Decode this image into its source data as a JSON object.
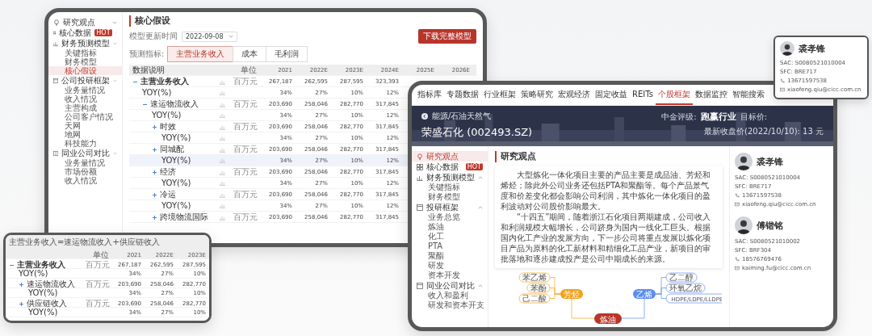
{
  "model_window": {
    "sidebar": [
      {
        "label": "研究观点"
      },
      {
        "label": "核心数据",
        "badge": "HOT"
      },
      {
        "label": "财务预测模型",
        "children": [
          {
            "label": "关键指标",
            "selected": false
          },
          {
            "label": "财务模型",
            "selected": false
          },
          {
            "label": "核心假设",
            "selected": true
          }
        ]
      },
      {
        "label": "公司投研框架",
        "children": [
          {
            "label": "业务量情况",
            "selected": false
          },
          {
            "label": "收入情况",
            "selected": false
          },
          {
            "label": "主营构成",
            "selected": false
          },
          {
            "label": "公司客户情况",
            "selected": false
          },
          {
            "label": "天网",
            "selected": false
          },
          {
            "label": "地网",
            "selected": false
          },
          {
            "label": "科技能力",
            "selected": false
          }
        ]
      },
      {
        "label": "同业公司对比",
        "children": [
          {
            "label": "业务量情况",
            "selected": false
          },
          {
            "label": "市场份额",
            "selected": false
          },
          {
            "label": "收入情况",
            "selected": false
          }
        ]
      }
    ],
    "title": "核心假设",
    "update_label": "模型更新时间",
    "update_value": "2022-09-08",
    "download_button": "下载完整模型",
    "metric_label": "预测指标:",
    "metric_tabs": [
      {
        "label": "主营业务收入",
        "selected": true
      },
      {
        "label": "成本",
        "selected": false
      },
      {
        "label": "毛利润",
        "selected": false
      }
    ],
    "table": {
      "columns": [
        "数据说明",
        "单位",
        "2021",
        "2022E",
        "2023E",
        "2024E",
        "2025E",
        "2026E"
      ],
      "rows": [
        {
          "label": "主营业务收入",
          "unit": "百万元",
          "values": [
            "267,187",
            "262,595",
            "287,595",
            "323,393"
          ],
          "expanded": true,
          "highlighted": false,
          "yoy": {
            "label": "YOY(%)",
            "values": [
              "34%",
              "27%",
              "10%",
              "12%"
            ],
            "highlighted": false
          },
          "children": [
            {
              "label": "速运物流收入",
              "unit": "百万元",
              "values": [
                "203,690",
                "258,046",
                "282,770",
                "317,845"
              ],
              "expanded": true,
              "highlighted": false,
              "yoy": {
                "label": "YOY(%)",
                "values": [
                  "34%",
                  "27%",
                  "10%",
                  "12%"
                ],
                "highlighted": false
              },
              "children": [
                {
                  "label": "时效",
                  "unit": "百万元",
                  "values": [
                    "203,690",
                    "258,046",
                    "282,770",
                    "317,845"
                  ],
                  "expanded": false,
                  "highlighted": false,
                  "yoy": {
                    "label": "YOY(%)",
                    "values": [
                      "34%",
                      "27%",
                      "10%",
                      "12%"
                    ],
                    "highlighted": false
                  }
                },
                {
                  "label": "同城配",
                  "unit": "百万元",
                  "values": [
                    "203,690",
                    "258,046",
                    "282,770",
                    "317,845"
                  ],
                  "expanded": false,
                  "highlighted": false,
                  "yoy": {
                    "label": "YOY(%)",
                    "values": [
                      "34%",
                      "27%",
                      "10%",
                      "12%"
                    ],
                    "highlighted": true
                  }
                },
                {
                  "label": "经济",
                  "unit": "百万元",
                  "values": [
                    "203,690",
                    "258,046",
                    "282,770",
                    "317,845"
                  ],
                  "expanded": false,
                  "highlighted": false,
                  "yoy": {
                    "label": "YOY(%)",
                    "values": [
                      "34%",
                      "27%",
                      "10%",
                      "12%"
                    ],
                    "highlighted": false
                  }
                },
                {
                  "label": "冷运",
                  "unit": "百万元",
                  "values": [
                    "203,690",
                    "258,046",
                    "282,770",
                    "317,845"
                  ],
                  "expanded": false,
                  "highlighted": false,
                  "yoy": {
                    "label": "YOY(%)",
                    "values": [
                      "34%",
                      "27%",
                      "10%",
                      "12%"
                    ],
                    "highlighted": false
                  }
                },
                {
                  "label": "跨境物流国际",
                  "unit": "百万元",
                  "values": [
                    "203,690",
                    "258,046",
                    "282,770",
                    "317,845"
                  ],
                  "expanded": false,
                  "highlighted": false
                }
              ]
            }
          ]
        }
      ]
    }
  },
  "mini_table": {
    "formula": "主营业务收入=速运物流收入+供应链收入",
    "columns": [
      "单位",
      "2021",
      "2022E",
      "2023E"
    ],
    "rows": [
      {
        "label": "主营业务收入",
        "unit": "百万元",
        "values": [
          "267,187",
          "262,595",
          "287,595"
        ],
        "expanded": true,
        "yoy": {
          "label": "YOY(%)",
          "values": [
            "34%",
            "27%",
            "10%"
          ]
        },
        "children": [
          {
            "label": "速运物流收入",
            "unit": "百万元",
            "values": [
              "203,690",
              "258,046",
              "282,770"
            ],
            "expanded": false,
            "yoy": {
              "label": "YOY(%)",
              "values": [
                "34%",
                "27%",
                "10%"
              ]
            }
          },
          {
            "label": "供应链收入",
            "unit": "百万元",
            "values": [
              "203,690",
              "258,046",
              "282,770"
            ],
            "expanded": false,
            "yoy": {
              "label": "YOY(%)",
              "values": [
                "34%",
                "27%",
                "10%"
              ]
            }
          }
        ]
      }
    ]
  },
  "stock_window": {
    "nav": [
      {
        "label": "指标库",
        "selected": false
      },
      {
        "label": "专题数据",
        "selected": false
      },
      {
        "label": "行业框架",
        "selected": false
      },
      {
        "label": "策略研究",
        "selected": false
      },
      {
        "label": "宏观经济",
        "selected": false
      },
      {
        "label": "固定收益",
        "selected": false
      },
      {
        "label": "REITs",
        "selected": false
      },
      {
        "label": "个股框架",
        "selected": true
      },
      {
        "label": "数据监控",
        "selected": false
      },
      {
        "label": "智能搜索",
        "selected": false
      }
    ],
    "banner": {
      "breadcrumb": "能源/石油天然气",
      "title": "荣盛石化 (002493.SZ)",
      "rating_label": "中金评级:",
      "rating": "跑赢行业",
      "target_label": "目标价:",
      "close_price": "最新收盘价(2022/10/10): 13 元"
    },
    "sidebar": [
      {
        "label": "研究观点",
        "selected": true
      },
      {
        "label": "核心数据",
        "badge": "HOT",
        "selected": false
      },
      {
        "label": "财务预测模型",
        "selected": false,
        "expanded": true,
        "children": [
          {
            "label": "关键指标",
            "selected": false
          },
          {
            "label": "财务模型",
            "selected": false
          }
        ]
      },
      {
        "label": "投研框架",
        "selected": false,
        "expanded": true,
        "children": [
          {
            "label": "业务总览",
            "selected": false
          },
          {
            "label": "炼油",
            "selected": false
          },
          {
            "label": "化工",
            "selected": false
          },
          {
            "label": "PTA",
            "selected": false
          },
          {
            "label": "聚酯",
            "selected": false
          },
          {
            "label": "研发",
            "selected": false
          },
          {
            "label": "资本开发",
            "selected": false
          }
        ]
      },
      {
        "label": "同业公司对比",
        "selected": false,
        "expanded": true,
        "children": [
          {
            "label": "收入和盈利",
            "selected": false
          },
          {
            "label": "研发和资本开支",
            "selected": false
          }
        ]
      }
    ],
    "section_title": "研究观点",
    "paragraphs": [
      "大型炼化一体化项目主要的产品主要是成品油、芳烃和烯烃；除此外公司业务还包括PTA和聚酯等。每个产品景气度和价差变化都会影响公司利润，其中炼化一体化项目的盈利波动对公司股价影响最大。",
      "“十四五”期间，随着浙江石化项目两期建成，公司收入和利润规模大幅增长，公司跻身为国内一线化工巨头。根据国内化工产业的发展方向，下一步公司将重点发展以炼化项目产品为原料的化工新材料和精细化工品产业，新项目的审批落地和逐步建成投产是公司中期成长的来源。"
    ],
    "mindmap": {
      "center": "炼油",
      "branches": [
        {
          "label": "芳烃",
          "color": "#f0a21c",
          "leaves": [
            "苯乙烯",
            "苯酚",
            "己二酸"
          ]
        },
        {
          "label": "乙烯",
          "color": "#5b8def",
          "leaves": [
            "乙二醇",
            "环氧乙烷",
            "HDPE/LDPE/LLDPE"
          ]
        }
      ]
    },
    "analysts": [
      {
        "name": "裘孝锋",
        "sac": "SAC: S0080521010004",
        "sfc": "SFC: BRE717",
        "phone": "13671597538",
        "email": "xiaofeng.qiu@cicc.com.cn"
      },
      {
        "name": "傅锴铭",
        "sac": "SAC: S0080521010002",
        "sfc": "SFC: BRF304",
        "phone": "18576769476",
        "email": "kaiming.fu@cicc.com.cn"
      }
    ]
  },
  "popup_card": {
    "name": "裘孝锋",
    "sac": "SAC: S0080521010004",
    "sfc": "SFC: BRE717",
    "phone": "13671597538",
    "email": "xiaofeng.qiu@cicc.com.cn"
  }
}
